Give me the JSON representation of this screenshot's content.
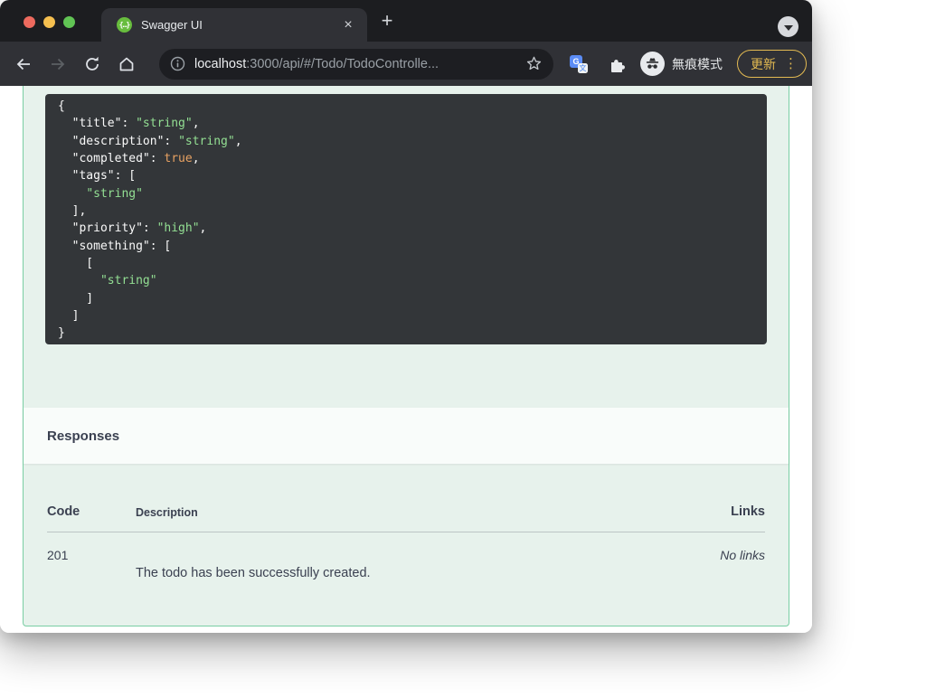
{
  "tab": {
    "title": "Swagger UI",
    "close_glyph": "×",
    "new_tab_glyph": "+",
    "favicon_glyph": "{…}"
  },
  "toolbar": {
    "url_host": "localhost",
    "url_rest": ":3000/api/#/Todo/TodoControlle...",
    "incognito_label": "無痕模式",
    "update_label": "更新",
    "menu_dots_glyph": "⋮"
  },
  "code_block": {
    "lines": [
      [
        [
          "p",
          "{"
        ]
      ],
      [
        [
          "p",
          "  \"title\": "
        ],
        [
          "s",
          "\"string\""
        ],
        [
          "p",
          ","
        ]
      ],
      [
        [
          "p",
          "  \"description\": "
        ],
        [
          "s",
          "\"string\""
        ],
        [
          "p",
          ","
        ]
      ],
      [
        [
          "p",
          "  \"completed\": "
        ],
        [
          "b",
          "true"
        ],
        [
          "p",
          ","
        ]
      ],
      [
        [
          "p",
          "  \"tags\": ["
        ]
      ],
      [
        [
          "p",
          "    "
        ],
        [
          "s",
          "\"string\""
        ]
      ],
      [
        [
          "p",
          "  ],"
        ]
      ],
      [
        [
          "p",
          "  \"priority\": "
        ],
        [
          "s",
          "\"high\""
        ],
        [
          "p",
          ","
        ]
      ],
      [
        [
          "p",
          "  \"something\": ["
        ]
      ],
      [
        [
          "p",
          "    ["
        ]
      ],
      [
        [
          "p",
          "      "
        ],
        [
          "s",
          "\"string\""
        ]
      ],
      [
        [
          "p",
          "    ]"
        ]
      ],
      [
        [
          "p",
          "  ]"
        ]
      ],
      [
        [
          "p",
          "}"
        ]
      ]
    ]
  },
  "responses": {
    "title": "Responses",
    "headers": {
      "code": "Code",
      "description": "Description",
      "links": "Links"
    },
    "rows": [
      {
        "code": "201",
        "description": "The todo has been successfully created.",
        "links": "No links"
      }
    ]
  },
  "colors": {
    "code_bg": "#333639",
    "code_plain": "#fafafa",
    "code_string": "#93df93",
    "code_boolean": "#e8a262",
    "opblock_bg": "#e7f2ec",
    "opblock_border": "#79cea3",
    "text_dark": "#3b4151",
    "update_gold": "#e3ba52",
    "favicon_green": "#68bd3e"
  }
}
